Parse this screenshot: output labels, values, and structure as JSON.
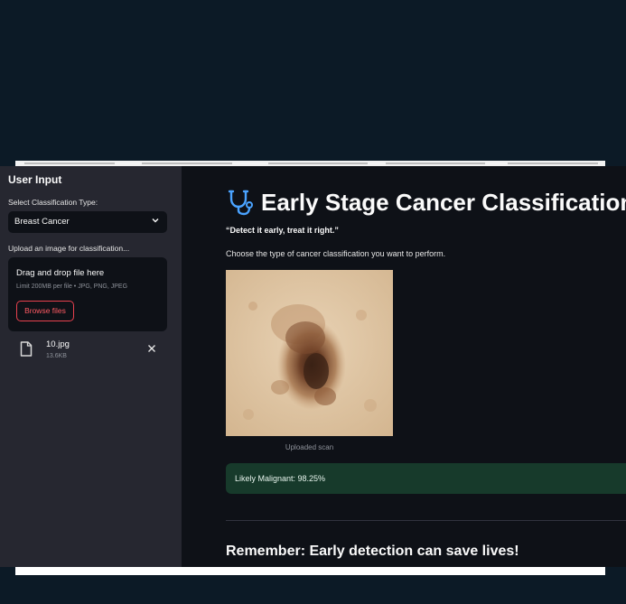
{
  "sidebar": {
    "title": "User Input",
    "select_label": "Select Classification Type:",
    "select_value": "Breast Cancer",
    "upload_label": "Upload an image for classification...",
    "dropzone": {
      "title": "Drag and drop file here",
      "subtitle": "Limit 200MB per file • JPG, PNG, JPEG",
      "browse_label": "Browse files"
    },
    "file": {
      "name": "10.jpg",
      "size": "13.6KB"
    }
  },
  "main": {
    "title": "Early Stage Cancer Classification",
    "tagline": "“Detect it early, treat it right.”",
    "description": "Choose the type of cancer classification you want to perform.",
    "image_caption": "Uploaded scan",
    "result": "Likely Malignant: 98.25%",
    "footer_heading": "Remember: Early detection can save lives!"
  },
  "colors": {
    "page_background": "#0c1a26",
    "app_background": "#0e1117",
    "sidebar_background": "#262730",
    "accent": "#ff4b4b",
    "icon_blue": "#4aa3ff",
    "success_background": "#173a2b"
  },
  "icons": {
    "select_chevron": "chevron-down-icon",
    "file": "file-icon",
    "remove": "close-icon",
    "title": "stethoscope-icon"
  }
}
